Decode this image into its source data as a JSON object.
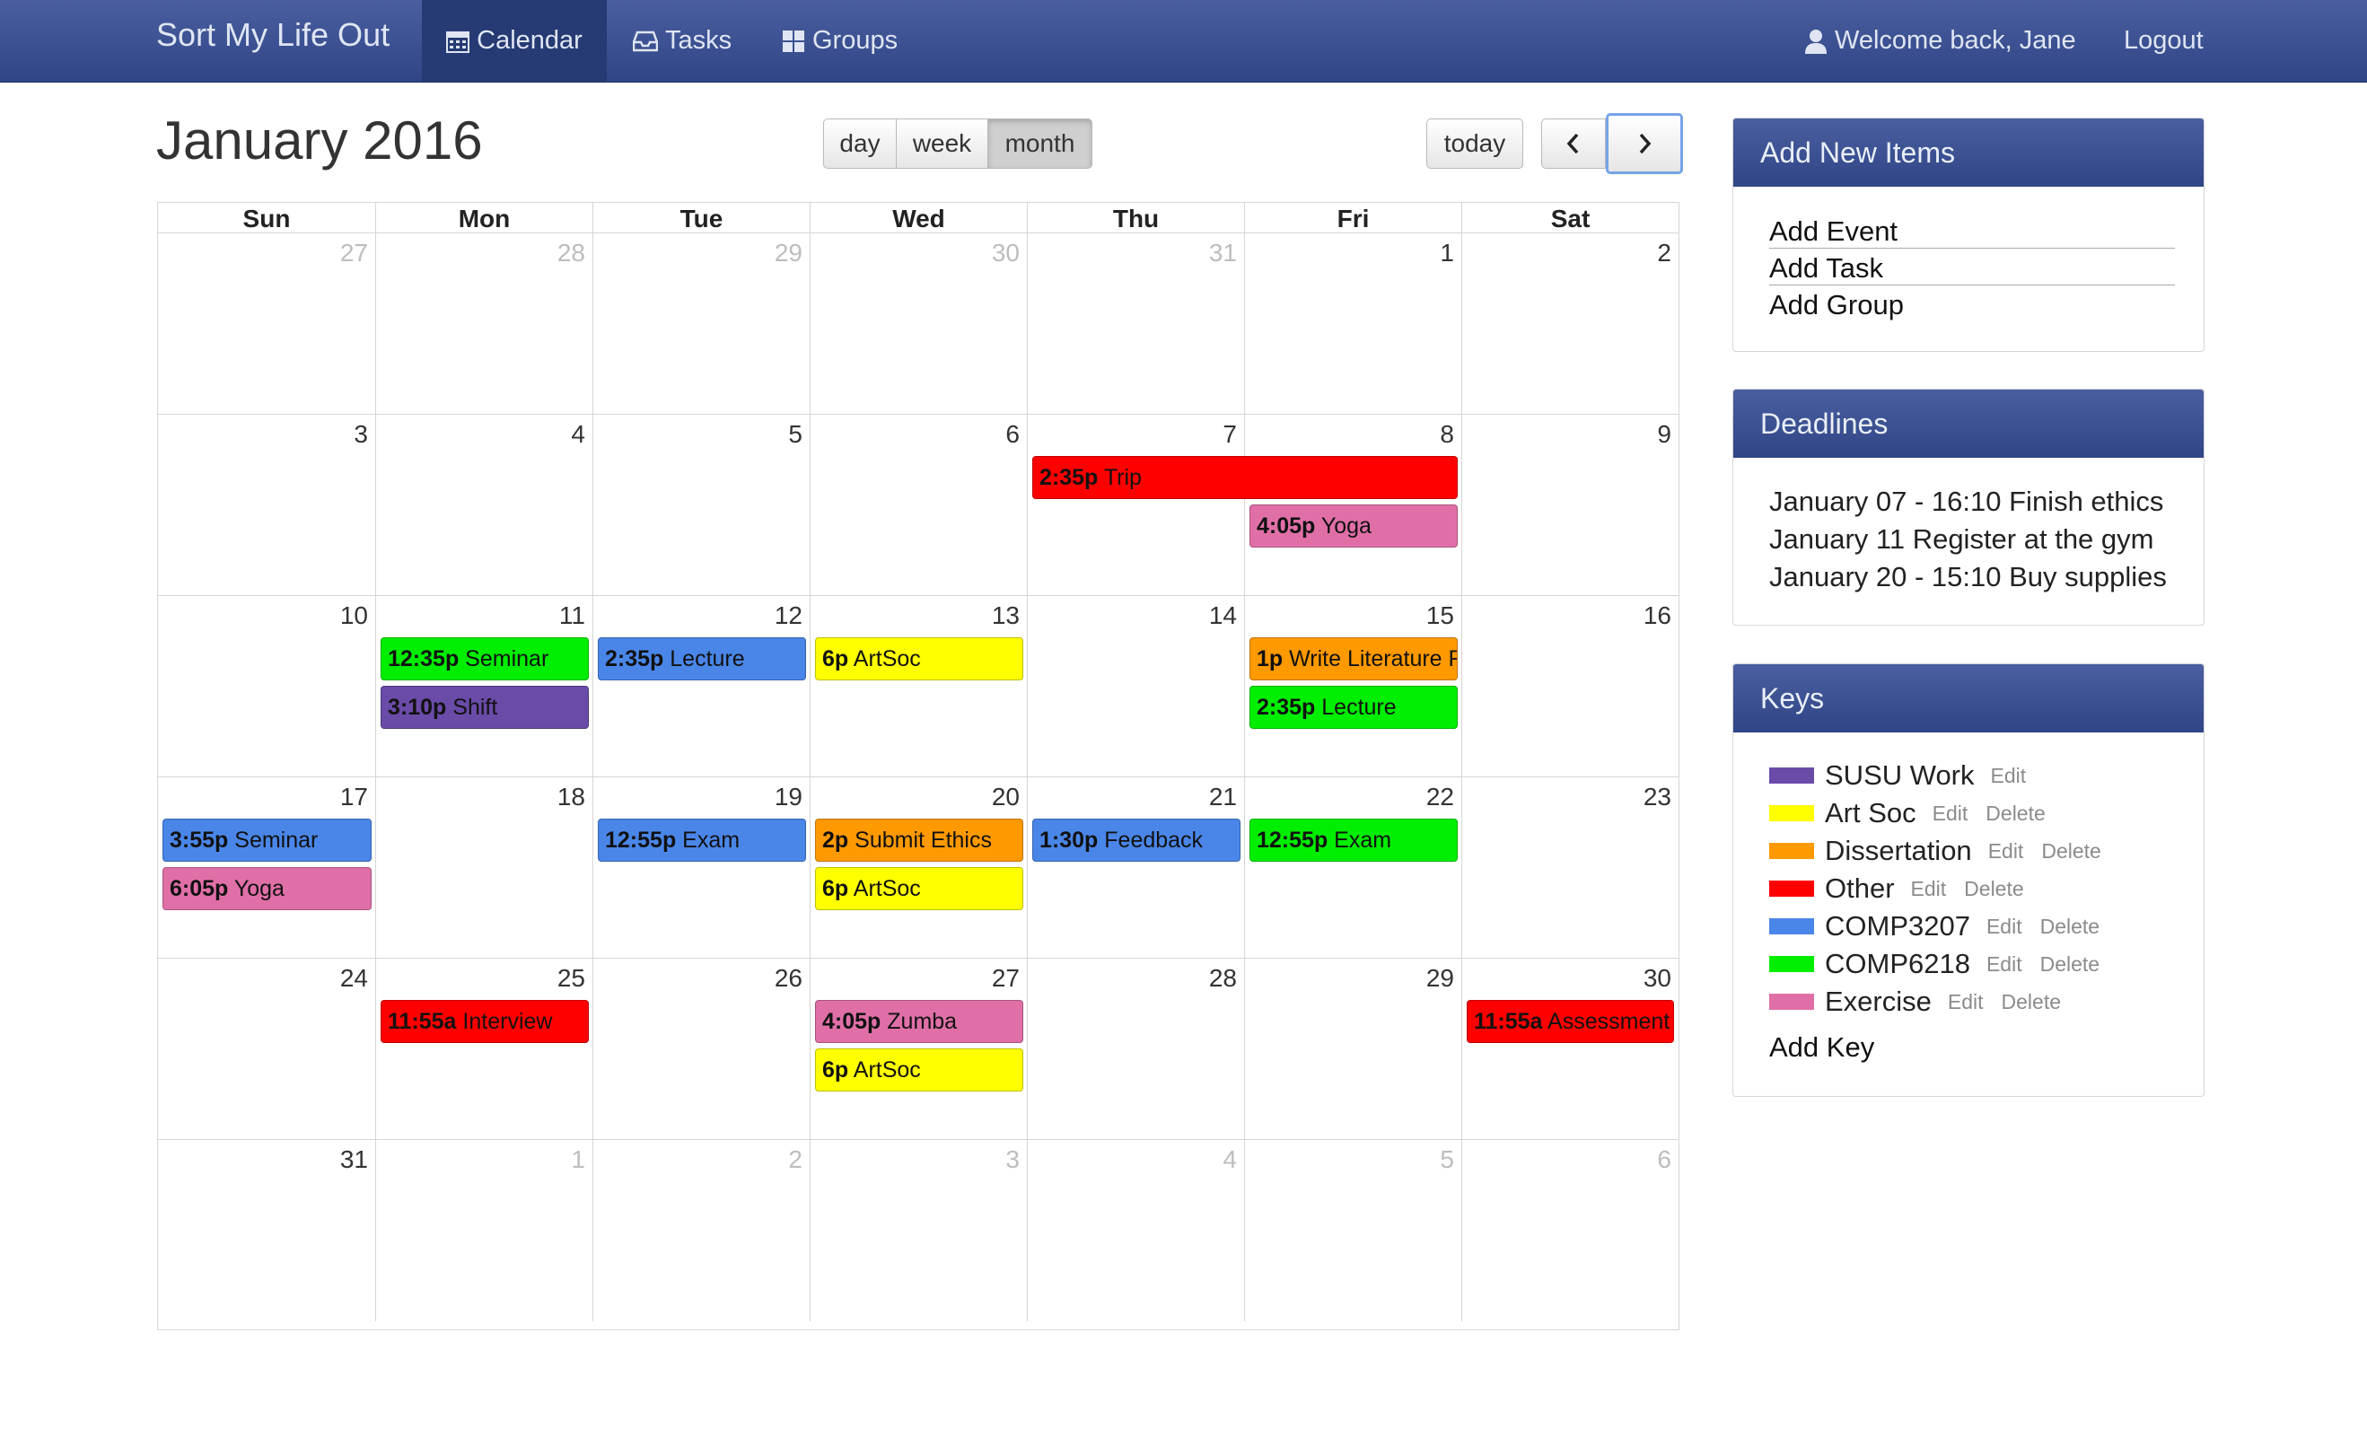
{
  "nav": {
    "brand": "Sort My Life Out",
    "items": [
      {
        "label": "Calendar"
      },
      {
        "label": "Tasks"
      },
      {
        "label": "Groups"
      }
    ],
    "welcome": "Welcome back, Jane",
    "logout": "Logout"
  },
  "toolbar": {
    "title": "January 2016",
    "views": [
      "day",
      "week",
      "month"
    ],
    "active_view": "month",
    "today": "today"
  },
  "calendar": {
    "weekdays": [
      "Sun",
      "Mon",
      "Tue",
      "Wed",
      "Thu",
      "Fri",
      "Sat"
    ],
    "weeks": [
      [
        {
          "n": "27",
          "o": true
        },
        {
          "n": "28",
          "o": true
        },
        {
          "n": "29",
          "o": true
        },
        {
          "n": "30",
          "o": true
        },
        {
          "n": "31",
          "o": true
        },
        {
          "n": "1"
        },
        {
          "n": "2"
        }
      ],
      [
        {
          "n": "3"
        },
        {
          "n": "4"
        },
        {
          "n": "5"
        },
        {
          "n": "6"
        },
        {
          "n": "7"
        },
        {
          "n": "8"
        },
        {
          "n": "9"
        }
      ],
      [
        {
          "n": "10"
        },
        {
          "n": "11"
        },
        {
          "n": "12"
        },
        {
          "n": "13"
        },
        {
          "n": "14"
        },
        {
          "n": "15"
        },
        {
          "n": "16"
        }
      ],
      [
        {
          "n": "17"
        },
        {
          "n": "18"
        },
        {
          "n": "19"
        },
        {
          "n": "20"
        },
        {
          "n": "21"
        },
        {
          "n": "22"
        },
        {
          "n": "23"
        }
      ],
      [
        {
          "n": "24"
        },
        {
          "n": "25"
        },
        {
          "n": "26"
        },
        {
          "n": "27"
        },
        {
          "n": "28"
        },
        {
          "n": "29"
        },
        {
          "n": "30"
        }
      ],
      [
        {
          "n": "31"
        },
        {
          "n": "1",
          "o": true
        },
        {
          "n": "2",
          "o": true
        },
        {
          "n": "3",
          "o": true
        },
        {
          "n": "4",
          "o": true
        },
        {
          "n": "5",
          "o": true
        },
        {
          "n": "6",
          "o": true
        }
      ]
    ],
    "events": [
      {
        "week": 1,
        "day": 4,
        "span": 2,
        "slot": 0,
        "time": "2:35p",
        "title": "Trip",
        "color": "#ff0000"
      },
      {
        "week": 1,
        "day": 5,
        "span": 1,
        "slot": 1,
        "time": "4:05p",
        "title": "Yoga",
        "color": "#e06fa7"
      },
      {
        "week": 2,
        "day": 1,
        "span": 1,
        "slot": 0,
        "time": "12:35p",
        "title": "Seminar",
        "color": "#00ee00"
      },
      {
        "week": 2,
        "day": 1,
        "span": 1,
        "slot": 1,
        "time": "3:10p",
        "title": "Shift",
        "color": "#6a4ba8"
      },
      {
        "week": 2,
        "day": 2,
        "span": 1,
        "slot": 0,
        "time": "2:35p",
        "title": "Lecture",
        "color": "#4a86e8"
      },
      {
        "week": 2,
        "day": 3,
        "span": 1,
        "slot": 0,
        "time": "6p",
        "title": "ArtSoc",
        "color": "#ffff00"
      },
      {
        "week": 2,
        "day": 5,
        "span": 1,
        "slot": 0,
        "time": "1p",
        "title": "Write Literature Review",
        "color": "#ff9900"
      },
      {
        "week": 2,
        "day": 5,
        "span": 1,
        "slot": 1,
        "time": "2:35p",
        "title": "Lecture",
        "color": "#00ee00"
      },
      {
        "week": 3,
        "day": 0,
        "span": 1,
        "slot": 0,
        "time": "3:55p",
        "title": "Seminar",
        "color": "#4a86e8"
      },
      {
        "week": 3,
        "day": 0,
        "span": 1,
        "slot": 1,
        "time": "6:05p",
        "title": "Yoga",
        "color": "#e06fa7"
      },
      {
        "week": 3,
        "day": 2,
        "span": 1,
        "slot": 0,
        "time": "12:55p",
        "title": "Exam",
        "color": "#4a86e8"
      },
      {
        "week": 3,
        "day": 3,
        "span": 1,
        "slot": 0,
        "time": "2p",
        "title": "Submit Ethics",
        "color": "#ff9900"
      },
      {
        "week": 3,
        "day": 3,
        "span": 1,
        "slot": 1,
        "time": "6p",
        "title": "ArtSoc",
        "color": "#ffff00"
      },
      {
        "week": 3,
        "day": 4,
        "span": 1,
        "slot": 0,
        "time": "1:30p",
        "title": "Feedback",
        "color": "#4a86e8"
      },
      {
        "week": 3,
        "day": 5,
        "span": 1,
        "slot": 0,
        "time": "12:55p",
        "title": "Exam",
        "color": "#00ee00"
      },
      {
        "week": 4,
        "day": 1,
        "span": 1,
        "slot": 0,
        "time": "11:55a",
        "title": "Interview",
        "color": "#ff0000"
      },
      {
        "week": 4,
        "day": 3,
        "span": 1,
        "slot": 0,
        "time": "4:05p",
        "title": "Zumba",
        "color": "#e06fa7"
      },
      {
        "week": 4,
        "day": 3,
        "span": 1,
        "slot": 1,
        "time": "6p",
        "title": "ArtSoc",
        "color": "#ffff00"
      },
      {
        "week": 4,
        "day": 6,
        "span": 1,
        "slot": 0,
        "time": "11:55a",
        "title": "Assessment",
        "color": "#ff0000"
      }
    ]
  },
  "add_panel": {
    "title": "Add New Items",
    "links": [
      "Add Event",
      "Add Task",
      "Add Group"
    ]
  },
  "deadlines": {
    "title": "Deadlines",
    "items": [
      "January 07 - 16:10 Finish ethics",
      "January 11 Register at the gym",
      "January 20 - 15:10 Buy supplies"
    ]
  },
  "keys": {
    "title": "Keys",
    "items": [
      {
        "name": "SUSU Work",
        "color": "#6a4ba8",
        "actions": [
          "Edit"
        ]
      },
      {
        "name": "Art Soc",
        "color": "#ffff00",
        "actions": [
          "Edit",
          "Delete"
        ]
      },
      {
        "name": "Dissertation",
        "color": "#ff9900",
        "actions": [
          "Edit",
          "Delete"
        ]
      },
      {
        "name": "Other",
        "color": "#ff0000",
        "actions": [
          "Edit",
          "Delete"
        ]
      },
      {
        "name": "COMP3207",
        "color": "#4a86e8",
        "actions": [
          "Edit",
          "Delete"
        ]
      },
      {
        "name": "COMP6218",
        "color": "#00ee00",
        "actions": [
          "Edit",
          "Delete"
        ]
      },
      {
        "name": "Exercise",
        "color": "#e06fa7",
        "actions": [
          "Edit",
          "Delete"
        ]
      }
    ],
    "add_label": "Add Key"
  }
}
